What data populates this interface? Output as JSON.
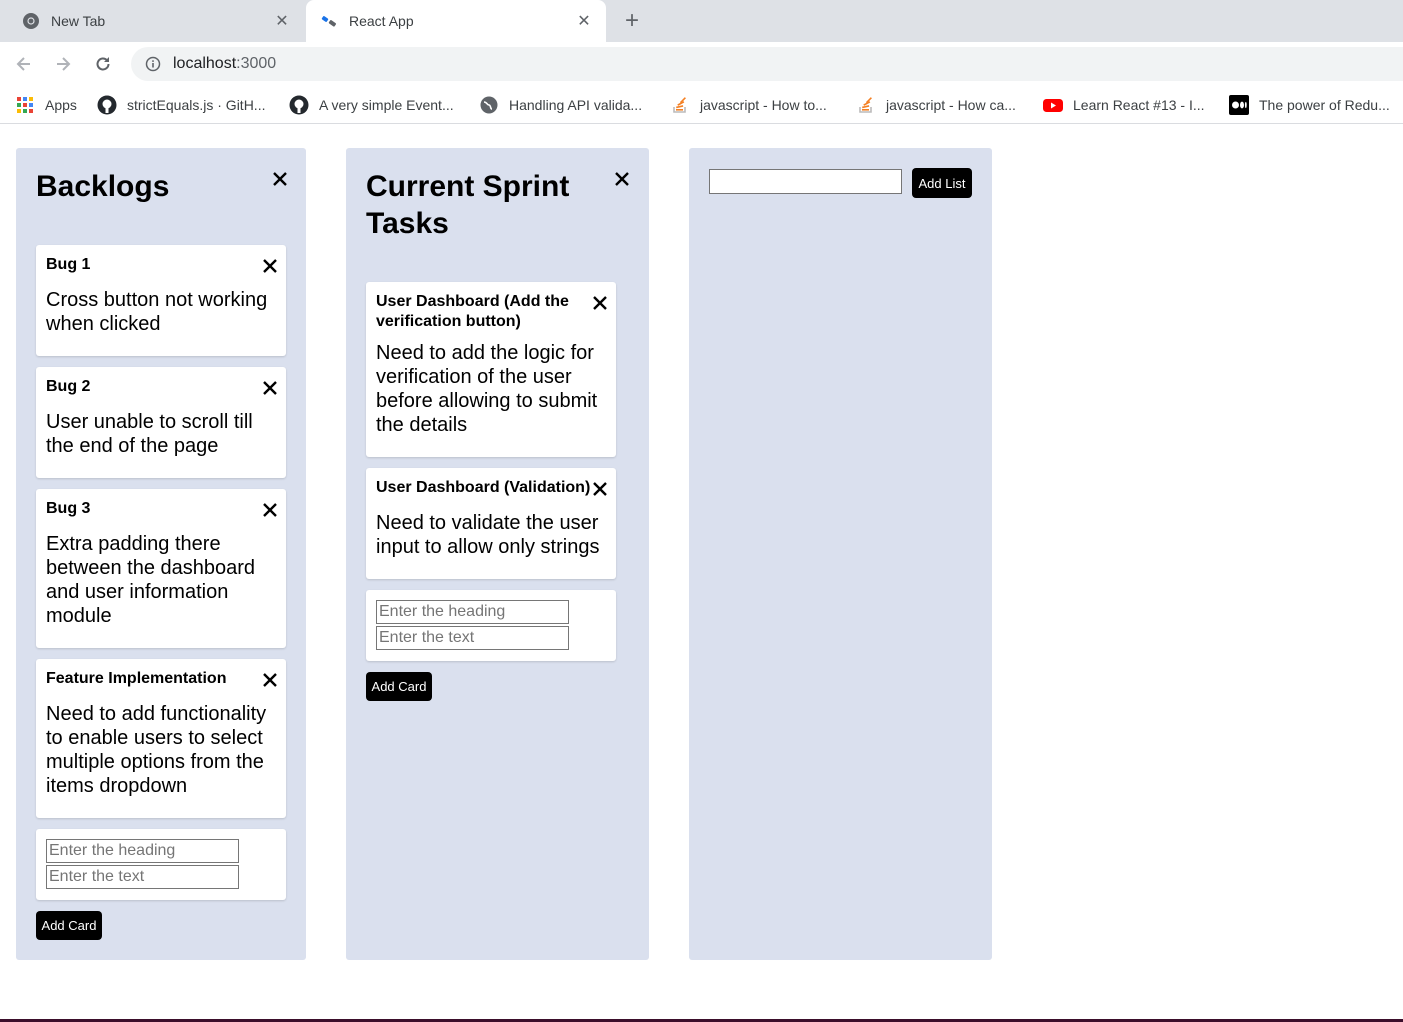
{
  "browser": {
    "tabs": [
      {
        "title": "New Tab",
        "icon": "chrome-icon",
        "active": false
      },
      {
        "title": "React App",
        "icon": "react-app-icon",
        "active": true
      }
    ],
    "url_host": "localhost",
    "url_port": ":3000",
    "bookmarks": [
      {
        "label": "Apps",
        "icon": "apps-grid-icon"
      },
      {
        "label": "strictEquals.js · GitH...",
        "icon": "github-icon"
      },
      {
        "label": "A very simple Event...",
        "icon": "github-icon"
      },
      {
        "label": "Handling API valida...",
        "icon": "globe-icon"
      },
      {
        "label": "javascript - How to...",
        "icon": "stackoverflow-icon"
      },
      {
        "label": "javascript - How ca...",
        "icon": "stackoverflow-icon"
      },
      {
        "label": "Learn React #13 - I...",
        "icon": "youtube-icon"
      },
      {
        "label": "The power of Redu...",
        "icon": "medium-icon"
      }
    ]
  },
  "board": {
    "lists": [
      {
        "title": "Backlogs",
        "cards": [
          {
            "heading": "Bug 1",
            "text": "Cross button not working when clicked"
          },
          {
            "heading": "Bug 2",
            "text": "User unable to scroll till the end of the page"
          },
          {
            "heading": "Bug 3",
            "text": "Extra padding there between the dashboard and user information module"
          },
          {
            "heading": "Feature Implementation",
            "text": "Need to add functionality to enable users to select multiple options from the items dropdown"
          }
        ],
        "heading_placeholder": "Enter the heading",
        "text_placeholder": "Enter the text",
        "add_card_label": "Add Card"
      },
      {
        "title": "Current Sprint Tasks",
        "cards": [
          {
            "heading": "User Dashboard (Add the verification button)",
            "text": "Need to add the logic for verification of the user before allowing to submit the details"
          },
          {
            "heading": "User Dashboard (Validation)",
            "text": "Need to validate the user input to allow only strings"
          }
        ],
        "heading_placeholder": "Enter the heading",
        "text_placeholder": "Enter the text",
        "add_card_label": "Add Card"
      }
    ],
    "new_list": {
      "input_value": "",
      "add_list_label": "Add List"
    }
  },
  "colors": {
    "list_background": "#dae0ee",
    "button_background": "#000000",
    "card_background": "#ffffff"
  }
}
